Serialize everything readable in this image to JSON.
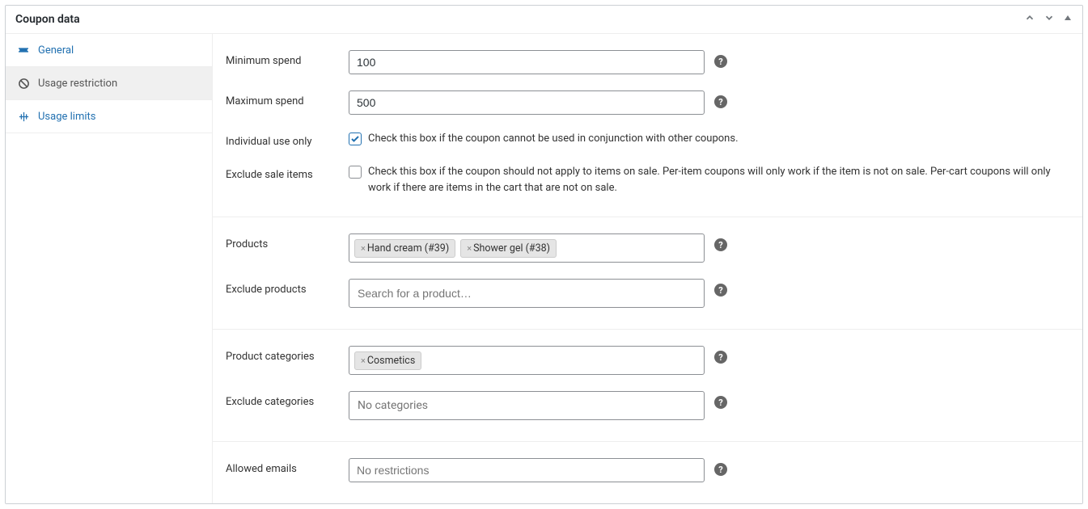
{
  "panel": {
    "title": "Coupon data"
  },
  "sidebar": {
    "items": [
      {
        "label": "General"
      },
      {
        "label": "Usage restriction"
      },
      {
        "label": "Usage limits"
      }
    ]
  },
  "fields": {
    "minimum_spend": {
      "label": "Minimum spend",
      "value": "100"
    },
    "maximum_spend": {
      "label": "Maximum spend",
      "value": "500"
    },
    "individual_use": {
      "label": "Individual use only",
      "description": "Check this box if the coupon cannot be used in conjunction with other coupons.",
      "checked": true
    },
    "exclude_sale": {
      "label": "Exclude sale items",
      "description": "Check this box if the coupon should not apply to items on sale. Per-item coupons will only work if the item is not on sale. Per-cart coupons will only work if there are items in the cart that are not on sale.",
      "checked": false
    },
    "products": {
      "label": "Products",
      "tags": [
        "Hand cream (#39)",
        "Shower gel (#38)"
      ]
    },
    "exclude_products": {
      "label": "Exclude products",
      "placeholder": "Search for a product…"
    },
    "product_categories": {
      "label": "Product categories",
      "tags": [
        "Cosmetics"
      ]
    },
    "exclude_categories": {
      "label": "Exclude categories",
      "placeholder": "No categories"
    },
    "allowed_emails": {
      "label": "Allowed emails",
      "placeholder": "No restrictions"
    }
  }
}
